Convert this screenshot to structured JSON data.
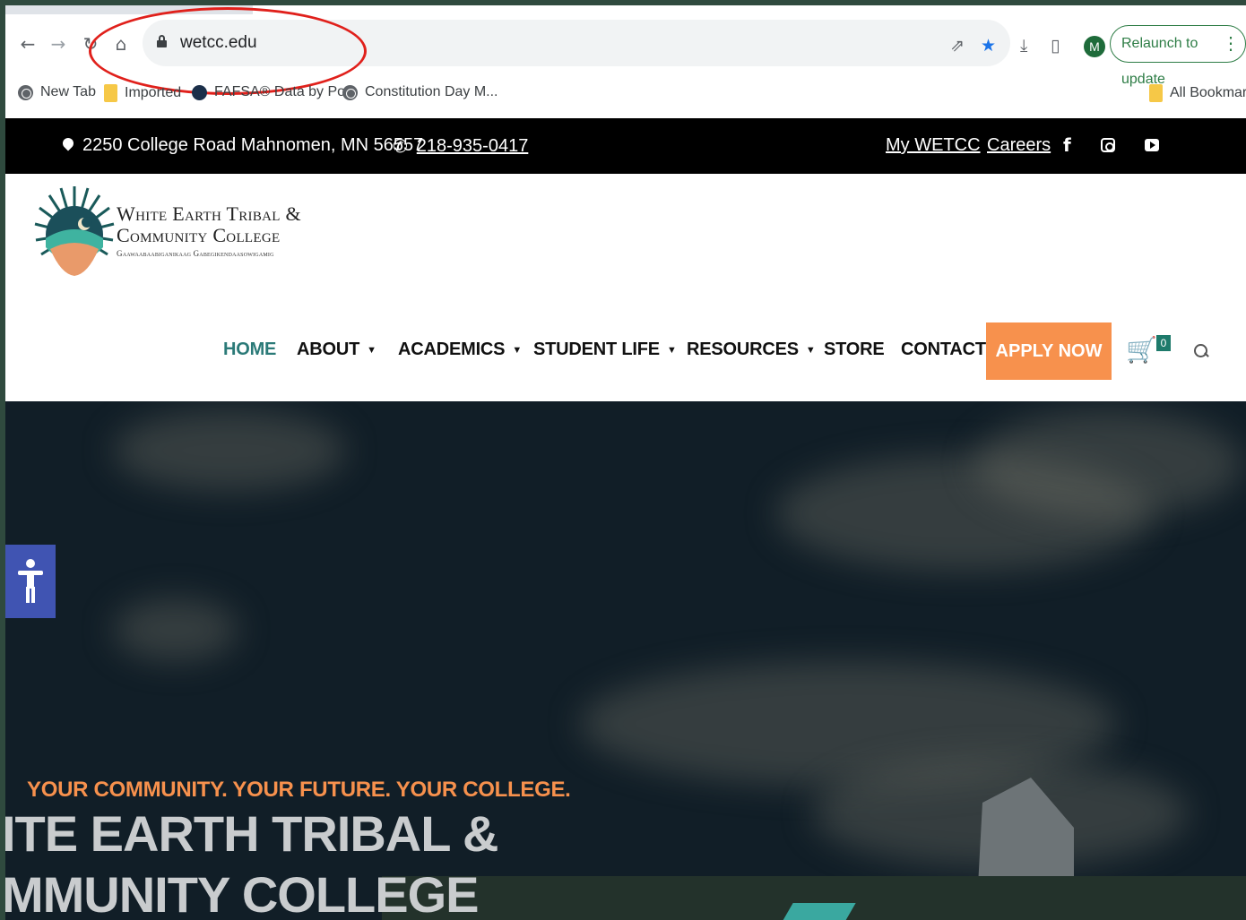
{
  "browser": {
    "url": "wetcc.edu",
    "profile_initial": "M",
    "relaunch_label": "Relaunch to update",
    "bookmarks": [
      {
        "label": "New Tab"
      },
      {
        "label": "Imported"
      },
      {
        "label": "FAFSA® Data by Po..."
      },
      {
        "label": "Constitution Day M..."
      }
    ],
    "all_bookmarks": "All Bookmarks"
  },
  "topbar": {
    "address": "2250 College Road Mahnomen, MN 56557",
    "phone": "218-935-0417",
    "my_wetcc": "My WETCC",
    "careers": "Careers"
  },
  "logo": {
    "line1": "White Earth Tribal &",
    "line2": "Community College",
    "subtitle": "Gaawaabaabiganikaag Gabegikendaasowigamig"
  },
  "nav": {
    "home": "HOME",
    "about": "ABOUT",
    "academics": "ACADEMICS",
    "student_life": "STUDENT LIFE",
    "resources": "RESOURCES",
    "store": "STORE",
    "contact": "CONTACT",
    "apply": "APPLY NOW",
    "cart_count": "0"
  },
  "hero": {
    "tagline": "YOUR COMMUNITY. YOUR FUTURE. YOUR COLLEGE.",
    "title_line1": "ITE EARTH TRIBAL &",
    "title_line2": "MMUNITY COLLEGE"
  },
  "colors": {
    "accent_orange": "#f7914d",
    "teal": "#2b7a78",
    "annotation_red": "#e0201b"
  }
}
